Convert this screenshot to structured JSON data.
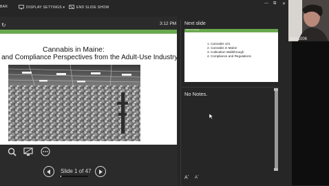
{
  "toolbar": {
    "left_label": "BAR",
    "display_settings": "DISPLAY SETTINGS ▾",
    "end_slide_show": "END SLIDE SHOW",
    "win_min": "—",
    "win_max": "⧉",
    "win_close": "✕"
  },
  "presenter": {
    "clock": "3:12 PM",
    "current_slide": {
      "title": "Cannabis in Maine:",
      "subtitle": "ion and Compliance Perspectives from the Adult-Use Industry"
    },
    "counter": "Slide 1 of 47",
    "progress_fraction": 0.021
  },
  "next_slide": {
    "label": "Next slide",
    "bar_text": "Table of Contents",
    "items": [
      "1. Cannabis 101",
      "2. Cannabis in Maine",
      "3. Cultivation Walkthrough",
      "4. Compliance and Regulations"
    ]
  },
  "notes": {
    "text": "No Notes."
  },
  "font_controls": {
    "increase": "A",
    "decrease": "A"
  },
  "participant": {
    "name": "dam1006"
  },
  "colors": {
    "accent_green": "#6aa84f",
    "background": "#262626"
  }
}
